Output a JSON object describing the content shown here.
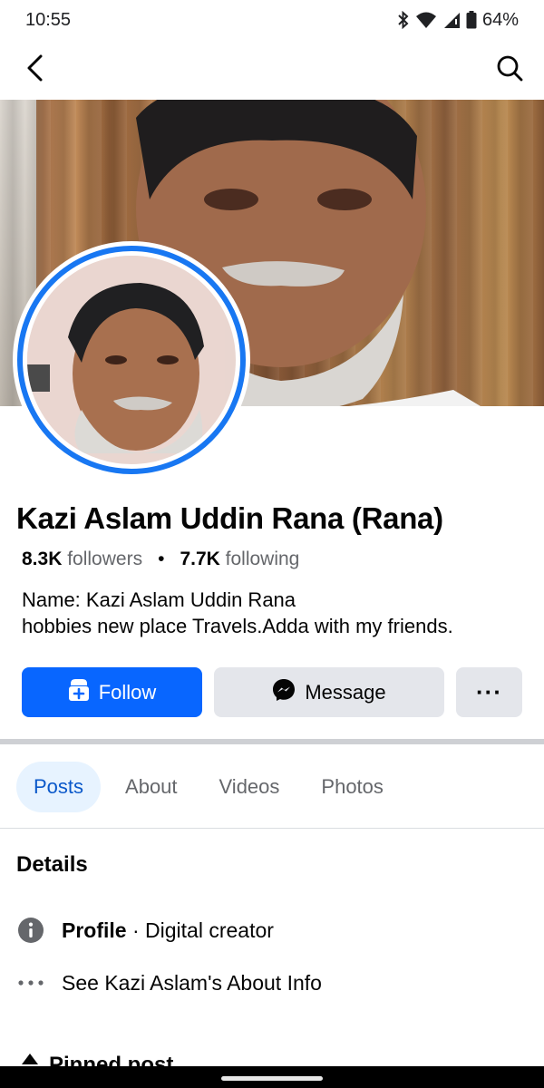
{
  "status_bar": {
    "time": "10:55",
    "battery": "64%",
    "icons": [
      "bluetooth-icon",
      "wifi-icon",
      "signal-icon",
      "battery-icon"
    ]
  },
  "top_nav": {
    "icons": [
      "back-arrow-icon",
      "search-icon"
    ]
  },
  "profile": {
    "name": "Kazi Aslam Uddin Rana (Rana)",
    "followers_count": "8.3K",
    "followers_label": "followers",
    "separator": "•",
    "following_count": "7.7K",
    "following_label": "following",
    "bio_line1": "Name: Kazi Aslam Uddin Rana",
    "bio_line2": "hobbies new place Travels.Adda with my friends."
  },
  "actions": {
    "follow_label": "Follow",
    "message_label": "Message",
    "more_label": "···"
  },
  "tabs": [
    {
      "label": "Posts",
      "active": true
    },
    {
      "label": "About",
      "active": false
    },
    {
      "label": "Videos",
      "active": false
    },
    {
      "label": "Photos",
      "active": false
    }
  ],
  "details": {
    "heading": "Details",
    "profile_label": "Profile",
    "profile_value": " · Digital creator",
    "about_link": "See Kazi Aslam's About Info"
  },
  "pinned": {
    "label": "Pinned post"
  },
  "colors": {
    "accent": "#0866ff",
    "ring": "#1877f2",
    "tab_active_bg": "#e7f3ff",
    "tab_active_text": "#0a58ca",
    "button_gray": "#e4e6eb"
  }
}
